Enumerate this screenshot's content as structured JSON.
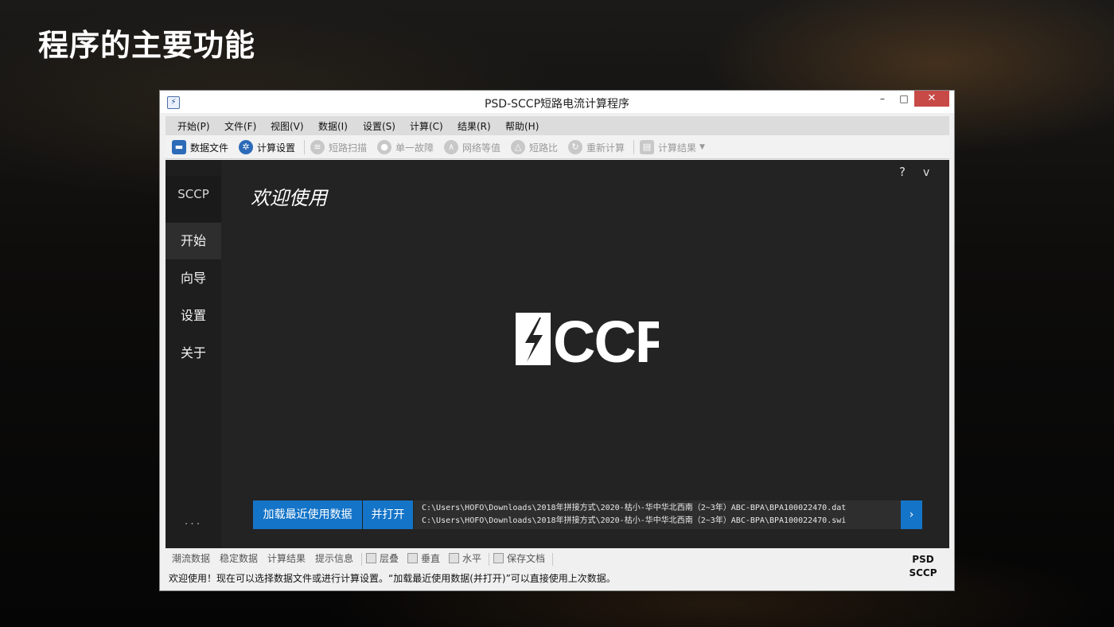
{
  "slide": {
    "title": "程序的主要功能"
  },
  "window": {
    "title": "PSD-SCCP短路电流计算程序",
    "controls": {
      "minimize": "–",
      "maximize": "□",
      "close": "✕"
    }
  },
  "menu": [
    "开始(P)",
    "文件(F)",
    "视图(V)",
    "数据(I)",
    "设置(S)",
    "计算(C)",
    "结果(R)",
    "帮助(H)"
  ],
  "toolbar": {
    "data_file": "数据文件",
    "calc_settings": "计算设置",
    "short_scan": "短路扫描",
    "single_fault": "单一故障",
    "network_equiv": "网络等值",
    "short_ratio": "短路比",
    "recalc": "重新计算",
    "calc_result": "计算结果"
  },
  "sidebar": {
    "brand": "SCCP",
    "items": [
      "开始",
      "向导",
      "设置",
      "关于"
    ],
    "more": "..."
  },
  "header_controls": {
    "help": "?",
    "collapse": "v"
  },
  "main": {
    "welcome": "欢迎使用",
    "logo_text": "CCP",
    "recent": {
      "load_label": "加载最近使用数据",
      "open_label": "并打开",
      "files": [
        "C:\\Users\\HOFO\\Downloads\\2018年拼接方式\\2020-枯小-华中华北西南（2~3年）ABC-BPA\\BPA100022470.dat",
        "C:\\Users\\HOFO\\Downloads\\2018年拼接方式\\2020-枯小-华中华北西南（2~3年）ABC-BPA\\BPA100022470.swi"
      ],
      "next": "›"
    }
  },
  "bottom_tabs": {
    "power_flow": "潮流数据",
    "stability": "稳定数据",
    "results": "计算结果",
    "hints": "提示信息",
    "cascade": "层叠",
    "vertical": "垂直",
    "horizontal": "水平",
    "save_doc": "保存文档"
  },
  "status": {
    "message": "欢迎使用！现在可以选择数据文件或进行计算设置。“加载最近使用数据(并打开)”可以直接使用上次数据。",
    "badge_line1": "PSD",
    "badge_line2": "SCCP"
  },
  "colors": {
    "accent": "#1474c8",
    "close_button": "#c74a47",
    "content_bg": "#232323"
  }
}
